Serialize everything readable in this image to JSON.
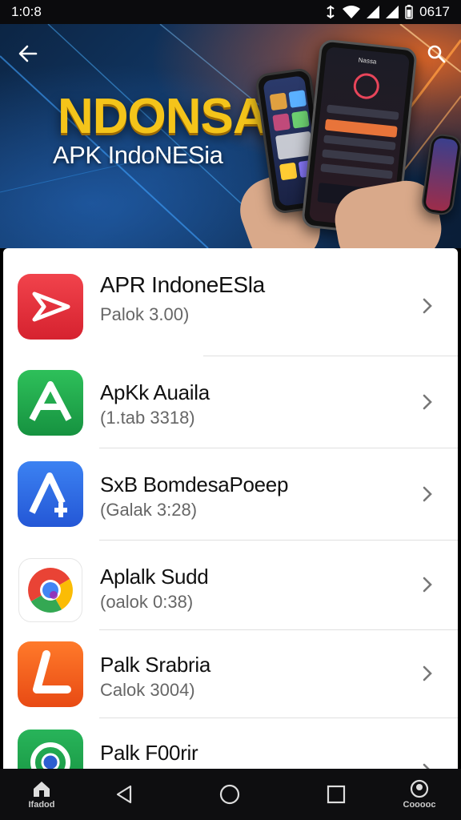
{
  "status_bar": {
    "time": "1:0:8",
    "battery_text": "0617"
  },
  "hero": {
    "title": "NDONSA",
    "subtitle": "APK IndoNESia",
    "back_icon": "arrow-left-icon",
    "search_icon": "search-icon",
    "phone_screen_title": "Nassa"
  },
  "apps": [
    {
      "title": "APR IndoneESla",
      "subtitle": "Palok 3.00)",
      "icon": "red-arrow-icon",
      "color": "#e8323f"
    },
    {
      "title": "ApKk Auaila",
      "subtitle": "(1.tab 3318)",
      "icon": "green-a-icon",
      "color": "#20a046"
    },
    {
      "title": "SxB BomdesaPoeep",
      "subtitle": "(Galak 3:28)",
      "icon": "blue-a-plus-icon",
      "color": "#2f6fe0"
    },
    {
      "title": "Aplalk Sudd",
      "subtitle": "(oalok 0:38)",
      "icon": "chrome-icon",
      "color": "#ffffff"
    },
    {
      "title": "Palk Srabria",
      "subtitle": "Calok 3004)",
      "icon": "orange-l-icon",
      "color": "#f25a1c"
    },
    {
      "title": "Palk F00rir",
      "subtitle": "",
      "icon": "green-camera-icon",
      "color": "#1ea34a"
    }
  ],
  "nav": {
    "home_label": "Ifadod",
    "right_label": "Cooooc",
    "back_icon": "back-triangle-icon",
    "home_circle_icon": "home-circle-icon",
    "recents_icon": "recents-square-icon"
  }
}
